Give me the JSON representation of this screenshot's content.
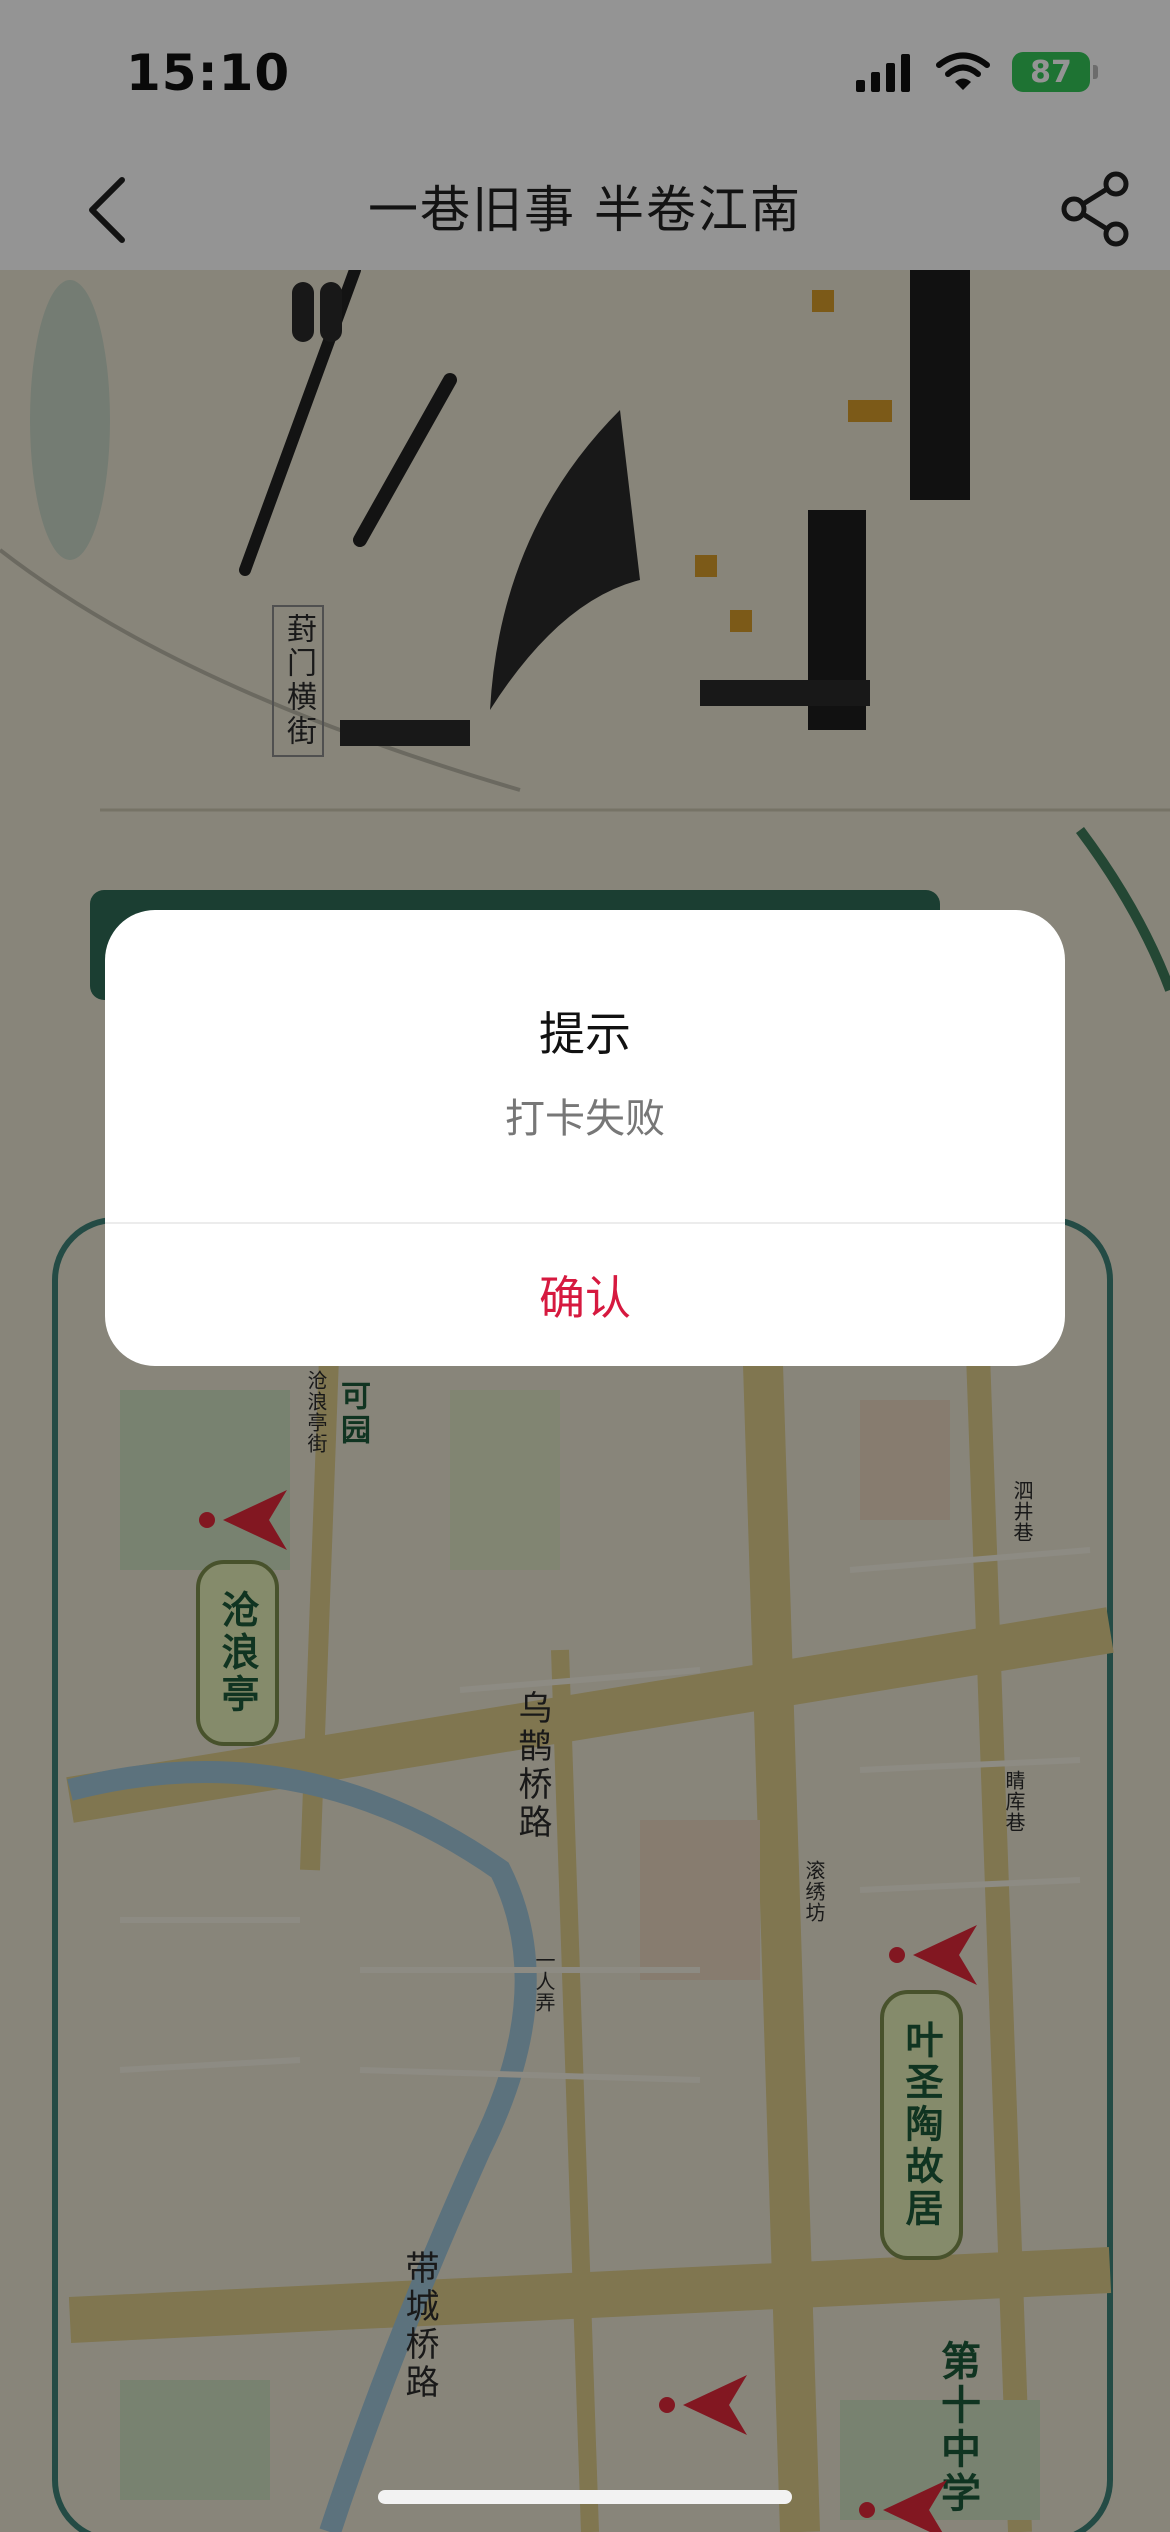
{
  "status_bar": {
    "time": "15:10",
    "battery_level": "87",
    "icons": [
      "signal-icon",
      "wifi-icon",
      "battery-icon"
    ]
  },
  "nav": {
    "title": "一巷旧事 半卷江南",
    "back_icon": "chevron-left-icon",
    "share_icon": "share-icon"
  },
  "map": {
    "labels": {
      "street_top": "葑门横街",
      "garden": "可园",
      "canglang_street": "沧浪亭街",
      "wuque_bridge": "乌鹊桥路",
      "sijing": "泗井巷",
      "xuku": "睛库巷",
      "gunxiu": "滚绣坊",
      "yiren": "一人弄",
      "daicheng_bridge": "带城桥路"
    },
    "landmarks": {
      "canglang": "沧浪亭",
      "yeshengtao": "叶圣陶故居",
      "school": "第十中学"
    }
  },
  "dialog": {
    "title": "提示",
    "message": "打卡失败",
    "confirm_label": "确认"
  },
  "colors": {
    "accent": "#d6193f",
    "battery": "#34c759",
    "plaque_text": "#1d5b3a"
  }
}
